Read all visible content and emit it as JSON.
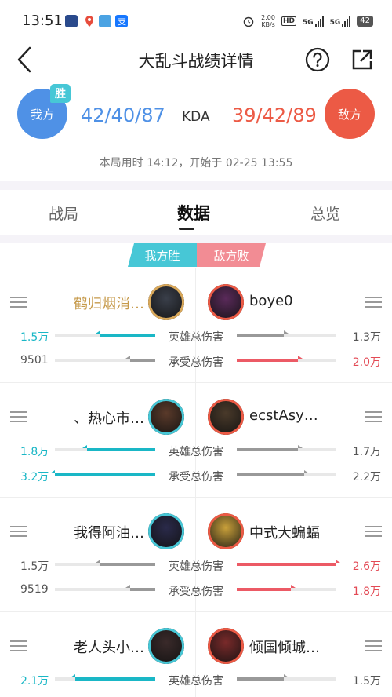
{
  "status_bar": {
    "time": "13:51",
    "net_speed_value": "2.00",
    "net_speed_unit": "KB/s",
    "hd_badge": "HD",
    "signal_1": "5G",
    "signal_2": "5G",
    "battery": "42"
  },
  "header": {
    "title": "大乱斗战绩详情",
    "back_icon": "chevron-left-icon",
    "help_icon": "question-circle-icon",
    "share_icon": "share-external-icon"
  },
  "score": {
    "our_team": "我方",
    "win_badge": "胜",
    "our_kda": "42/40/87",
    "kda_label": "KDA",
    "enemy_kda": "39/42/89",
    "enemy_team": "敌方",
    "time_info": "本局用时 14:12，开始于 02-25 13:55",
    "colors": {
      "our": "#4f91e6",
      "enemy": "#ec5a45",
      "win": "#47c7d6"
    }
  },
  "tabs": [
    {
      "label": "战局"
    },
    {
      "label": "数据",
      "active": true
    },
    {
      "label": "总览"
    }
  ],
  "result": {
    "our": "我方胜",
    "enemy": "敌方败"
  },
  "stat_labels": {
    "damage": "英雄总伤害",
    "taken": "承受总伤害"
  },
  "players": [
    {
      "left": {
        "name": "鹤归烟消…",
        "mvp": true,
        "damage": "1.5万",
        "damage_pct": 0.55,
        "damage_hi": true,
        "taken": "9501",
        "taken_pct": 0.25,
        "taken_hi": false
      },
      "right": {
        "name": "boye0",
        "damage": "1.3万",
        "damage_pct": 0.48,
        "damage_hi": false,
        "taken": "2.0万",
        "taken_pct": 0.62,
        "taken_hi": true
      }
    },
    {
      "left": {
        "name": "、热心市…",
        "mvp": false,
        "damage": "1.8万",
        "damage_pct": 0.68,
        "damage_hi": true,
        "taken": "3.2万",
        "taken_pct": 1.0,
        "taken_hi": true
      },
      "right": {
        "name": "ecstAsy…",
        "damage": "1.7万",
        "damage_pct": 0.62,
        "damage_hi": false,
        "taken": "2.2万",
        "taken_pct": 0.68,
        "taken_hi": false
      }
    },
    {
      "left": {
        "name": "我得阿油…",
        "mvp": false,
        "damage": "1.5万",
        "damage_pct": 0.55,
        "damage_hi": false,
        "taken": "9519",
        "taken_pct": 0.25,
        "taken_hi": false
      },
      "right": {
        "name": "中式大蝙蝠",
        "damage": "2.6万",
        "damage_pct": 1.0,
        "damage_hi": true,
        "taken": "1.8万",
        "taken_pct": 0.55,
        "taken_hi": true
      }
    },
    {
      "left": {
        "name": "老人头小…",
        "mvp": false,
        "damage": "2.1万",
        "damage_pct": 0.8,
        "damage_hi": true,
        "taken": "",
        "taken_pct": 0,
        "taken_hi": false
      },
      "right": {
        "name": "倾国倾城…",
        "damage": "1.5万",
        "damage_pct": 0.48,
        "damage_hi": false,
        "taken": "",
        "taken_pct": 0,
        "taken_hi": false
      }
    }
  ]
}
